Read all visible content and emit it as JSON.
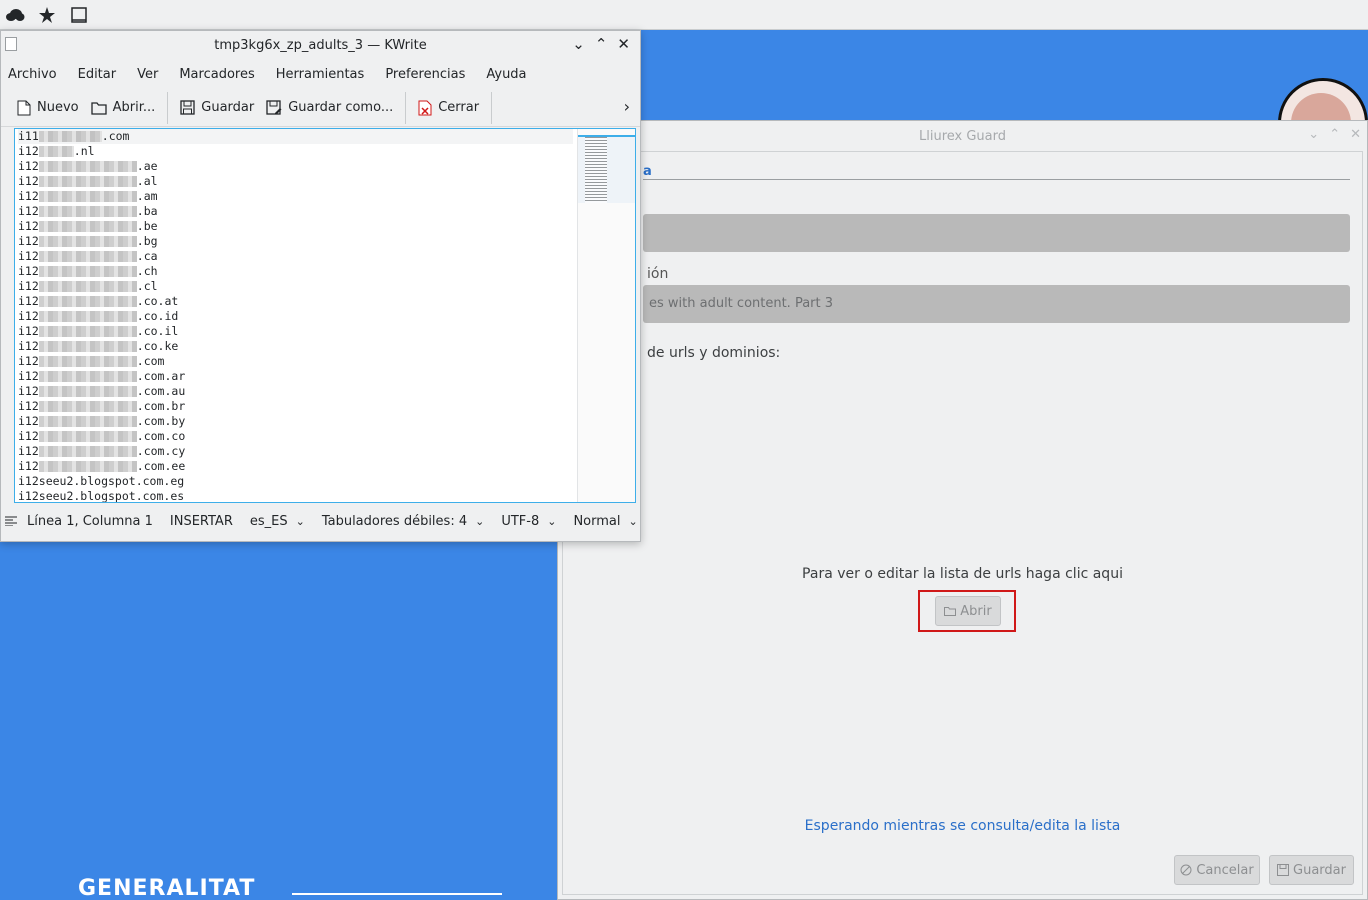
{
  "topbar": {
    "icons": [
      "cloud-icon",
      "star-icon",
      "window-icon"
    ]
  },
  "kwrite": {
    "title": "tmp3kg6x_zp_adults_3 — KWrite",
    "menu": [
      "Archivo",
      "Editar",
      "Ver",
      "Marcadores",
      "Herramientas",
      "Preferencias",
      "Ayuda"
    ],
    "toolbar": {
      "new_label": "Nuevo",
      "open_label": "Abrir...",
      "save_label": "Guardar",
      "saveas_label": "Guardar como...",
      "close_label": "Cerrar"
    },
    "lines": [
      {
        "prefix": "i11",
        "blur": 9,
        "suffix": ".com"
      },
      {
        "prefix": "i12",
        "blur": 5,
        "suffix": ".nl"
      },
      {
        "prefix": "i12",
        "blur": 14,
        "suffix": ".ae"
      },
      {
        "prefix": "i12",
        "blur": 14,
        "suffix": ".al"
      },
      {
        "prefix": "i12",
        "blur": 14,
        "suffix": ".am"
      },
      {
        "prefix": "i12",
        "blur": 14,
        "suffix": ".ba"
      },
      {
        "prefix": "i12",
        "blur": 14,
        "suffix": ".be"
      },
      {
        "prefix": "i12",
        "blur": 14,
        "suffix": ".bg"
      },
      {
        "prefix": "i12",
        "blur": 14,
        "suffix": ".ca"
      },
      {
        "prefix": "i12",
        "blur": 14,
        "suffix": ".ch"
      },
      {
        "prefix": "i12",
        "blur": 14,
        "suffix": ".cl"
      },
      {
        "prefix": "i12",
        "blur": 14,
        "suffix": ".co.at"
      },
      {
        "prefix": "i12",
        "blur": 14,
        "suffix": ".co.id"
      },
      {
        "prefix": "i12",
        "blur": 14,
        "suffix": ".co.il"
      },
      {
        "prefix": "i12",
        "blur": 14,
        "suffix": ".co.ke"
      },
      {
        "prefix": "i12",
        "blur": 14,
        "suffix": ".com"
      },
      {
        "prefix": "i12",
        "blur": 14,
        "suffix": ".com.ar"
      },
      {
        "prefix": "i12",
        "blur": 14,
        "suffix": ".com.au"
      },
      {
        "prefix": "i12",
        "blur": 14,
        "suffix": ".com.br"
      },
      {
        "prefix": "i12",
        "blur": 14,
        "suffix": ".com.by"
      },
      {
        "prefix": "i12",
        "blur": 14,
        "suffix": ".com.co"
      },
      {
        "prefix": "i12",
        "blur": 14,
        "suffix": ".com.cy"
      },
      {
        "prefix": "i12",
        "blur": 14,
        "suffix": ".com.ee"
      },
      {
        "prefix": "i12seeu2.blogspot.com.eg",
        "blur": 0,
        "suffix": ""
      },
      {
        "prefix": "i12seeu2.blogspot.com.es",
        "blur": 0,
        "suffix": ""
      }
    ],
    "status": {
      "position": "Línea 1, Columna 1",
      "mode": "INSERTAR",
      "lang": "es_ES",
      "tabs": "Tabuladores débiles: 4",
      "encoding": "UTF-8",
      "highlight": "Normal"
    }
  },
  "guard": {
    "title": "Lliurex Guard",
    "tab_label": "a",
    "desc_label": "ión",
    "desc_value": "es with adult content. Part 3",
    "list_label": "de urls y dominios:",
    "hint": "Para ver o editar la lista de urls haga clic aqui",
    "open_label": "Abrir",
    "waiting": "Esperando mientras se consulta/edita la lista",
    "cancel_label": "Cancelar",
    "save_label": "Guardar"
  },
  "desktop": {
    "logo_text": "GENERALITAT"
  }
}
